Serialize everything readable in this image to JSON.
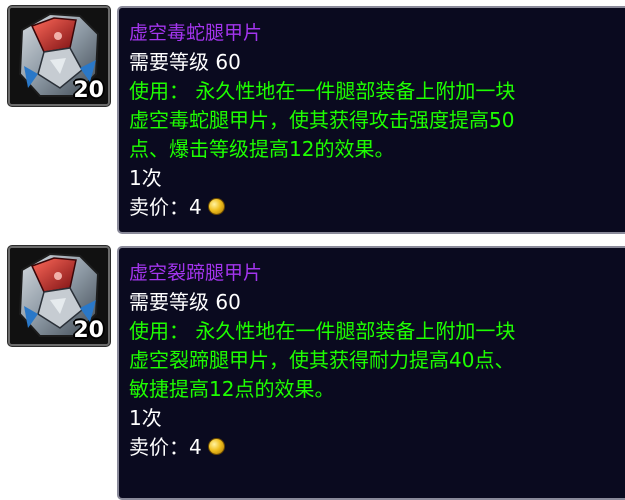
{
  "items": [
    {
      "name": "虚空毒蛇腿甲片",
      "stack_count": "20",
      "level_requirement": "需要等级 60",
      "use_lines": [
        "使用： 永久性地在一件腿部装备上附加一块",
        "虚空毒蛇腿甲片，使其获得攻击强度提高50",
        "点、爆击等级提高12的效果。"
      ],
      "charges": "1次",
      "sell_price_label": "卖价：",
      "sell_price_value": "4"
    },
    {
      "name": "虚空裂蹄腿甲片",
      "stack_count": "20",
      "level_requirement": "需要等级 60",
      "use_lines": [
        "使用： 永久性地在一件腿部装备上附加一块",
        "虚空裂蹄腿甲片，使其获得耐力提高40点、",
        "敏捷提高12点的效果。"
      ],
      "charges": "1次",
      "sell_price_label": "卖价：",
      "sell_price_value": "4"
    }
  ],
  "colors": {
    "item_name_epic": "#a335ee",
    "use_text_green": "#1eff00",
    "tooltip_background": "#0a0a1f",
    "tooltip_border": "#8a8a9a"
  },
  "icons": {
    "item_icon": "leg-armor-kit-icon",
    "currency_icon": "gold-coin-icon"
  }
}
